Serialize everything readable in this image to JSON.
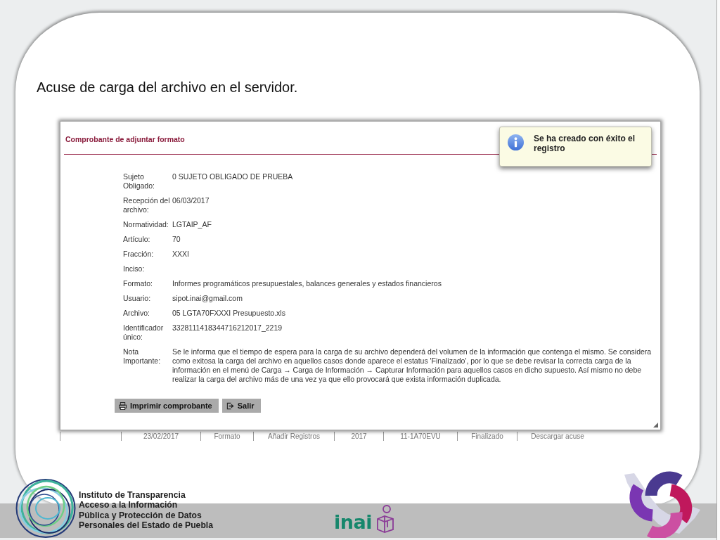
{
  "slide": {
    "heading": "Acuse de carga del archivo en el servidor."
  },
  "dialog": {
    "title": "Comprobante de adjuntar formato",
    "fields": [
      {
        "label": "Sujeto Obligado:",
        "value": "0 SUJETO OBLIGADO DE PRUEBA"
      },
      {
        "label": "Recepción del archivo:",
        "value": "06/03/2017"
      },
      {
        "label": "Normatividad:",
        "value": "LGTAIP_AF"
      },
      {
        "label": "Artículo:",
        "value": "70"
      },
      {
        "label": "Fracción:",
        "value": "XXXI"
      },
      {
        "label": "Inciso:"
      },
      {
        "label": "Formato:",
        "value": "Informes programáticos presupuestales, balances generales y estados financieros"
      },
      {
        "label": "Usuario:",
        "value": "sipot.inai@gmail.com"
      },
      {
        "label": "Archivo:",
        "value": "05 LGTA70FXXXI Presupuesto.xls"
      },
      {
        "label": "Identificador único:",
        "value": "3328111418344716212017_2219"
      },
      {
        "label": "Nota Importante:",
        "value": "Se le informa que el tiempo de espera para la carga de su archivo dependerá del volumen de la información que contenga el mismo. Se considera como exitosa la carga del archivo en aquellos casos donde aparece el estatus 'Finalizado', por lo que se debe revisar la correcta carga de la información en el menú de Carga → Carga de Información → Capturar Información para aquellos casos en dicho supuesto. Así mismo no debe realizar la carga del archivo más de una vez ya que ello provocará que exista información duplicada."
      }
    ],
    "buttons": [
      {
        "kind": "print",
        "label": "Imprimir comprobante"
      },
      {
        "kind": "exit",
        "label": "Salir"
      }
    ]
  },
  "notification": {
    "message": "Se ha creado con éxito el registro"
  },
  "background_table_row": {
    "cells": [
      "23/02/2017",
      "Formato",
      "Añadir Registros",
      "2017",
      "11-1A70EVU",
      "Finalizado",
      "Descargar acuse"
    ]
  },
  "footer": {
    "institute_name": [
      "Instituto de Transparencia",
      "Acceso a la Información",
      "Pública y Protección de Datos",
      "Personales del Estado de Puebla"
    ],
    "brand": "inai"
  }
}
